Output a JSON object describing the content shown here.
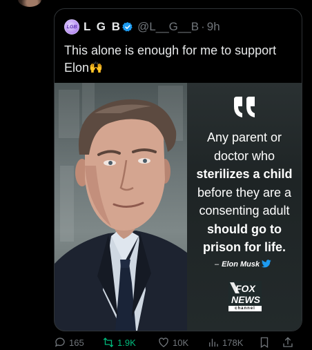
{
  "quoted_post": {
    "avatar_text": "LGB",
    "display_name": "L G B",
    "handle": "@L__G__B",
    "separator": "·",
    "time": "9h",
    "text": "This alone is enough for me to support Elon",
    "emoji": "🙌"
  },
  "media": {
    "quote_lines": [
      {
        "text": "Any parent or",
        "bold": false
      },
      {
        "text": "doctor who",
        "bold": false
      },
      {
        "text": "sterilizes a child",
        "bold": true
      },
      {
        "text": "before they are a",
        "bold": false
      },
      {
        "text": "consenting adult",
        "bold": false
      },
      {
        "text": "should go to",
        "bold": true
      },
      {
        "text": "prison for life.",
        "bold": true
      }
    ],
    "attribution_dash": "–",
    "attribution": "Elon Musk",
    "logo_line1": "FOX",
    "logo_line2": "NEWS",
    "logo_sub": "channel"
  },
  "actions": {
    "replies": "165",
    "retweets": "1.9K",
    "likes": "10K",
    "views": "178K"
  },
  "colors": {
    "background": "#000000",
    "border": "#2f3336",
    "secondary_text": "#71767b",
    "verified_blue": "#1d9bf0",
    "retweet_green": "#00ba7c"
  }
}
